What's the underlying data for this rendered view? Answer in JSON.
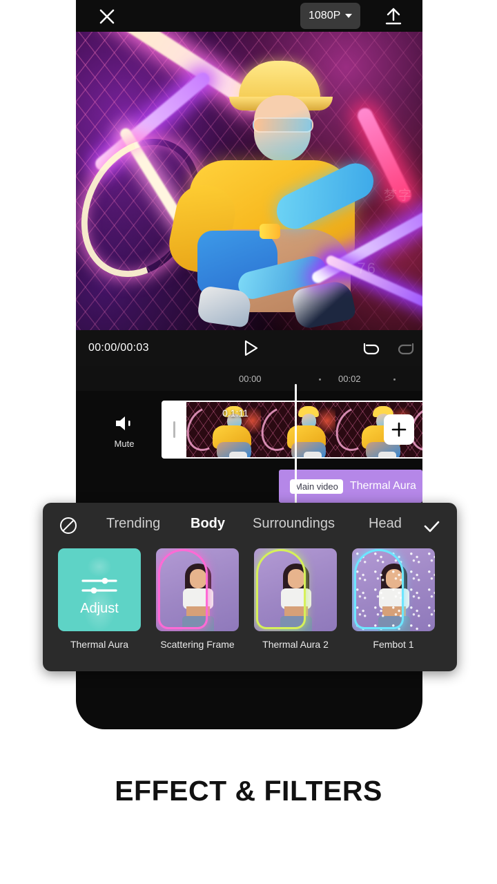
{
  "topbar": {
    "close_icon": "close-icon",
    "resolution_label": "1080P",
    "export_icon": "export-icon"
  },
  "player": {
    "timecode": "00:00/00:03",
    "play_icon": "play-icon",
    "undo_icon": "undo-icon",
    "redo_icon": "redo-icon"
  },
  "timeline": {
    "ruler_ticks": [
      "00:00",
      "00:02"
    ],
    "mute_label": "Mute",
    "mute_icon": "speaker-mute-icon",
    "clip_duration": "0.1:11",
    "add_icon": "plus-icon",
    "effect_track": {
      "tag": "Main video",
      "name": "Thermal Aura"
    }
  },
  "effects_panel": {
    "none_icon": "ban-icon",
    "confirm_icon": "check-icon",
    "tabs": [
      {
        "label": "Trending",
        "active": false
      },
      {
        "label": "Body",
        "active": true
      },
      {
        "label": "Surroundings",
        "active": false
      },
      {
        "label": "Head",
        "active": false
      }
    ],
    "items": [
      {
        "label": "Thermal Aura",
        "selected": true,
        "overlay_label": "Adjust",
        "overlay_icon": "sliders-icon",
        "accent": "#5ed3c6"
      },
      {
        "label": "Scattering Frame",
        "selected": false,
        "accent": "#ff6ad5"
      },
      {
        "label": "Thermal Aura 2",
        "selected": false,
        "accent": "#d6f05a"
      },
      {
        "label": "Fembot 1",
        "selected": false,
        "accent": "#6de6ff"
      }
    ]
  },
  "preview": {
    "watermark_1": "梦字",
    "watermark_2": "76"
  },
  "caption": "EFFECT & FILTERS"
}
